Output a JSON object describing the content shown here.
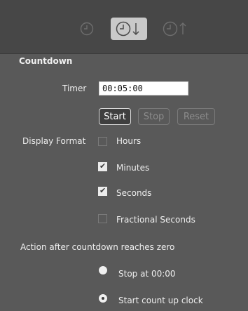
{
  "toolbar": {
    "modes": [
      {
        "name": "clock",
        "icon": "clock-icon",
        "active": false
      },
      {
        "name": "countdown",
        "icon": "clock-down-arrow-icon",
        "active": true
      },
      {
        "name": "countup",
        "icon": "clock-up-arrow-icon",
        "active": false
      }
    ]
  },
  "section": {
    "title": "Countdown"
  },
  "timer": {
    "label": "Timer",
    "value": "00:05:00"
  },
  "buttons": {
    "start": "Start",
    "stop": "Stop",
    "reset": "Reset"
  },
  "display_format": {
    "label": "Display Format",
    "options": [
      {
        "label": "Hours",
        "checked": false
      },
      {
        "label": "Minutes",
        "checked": true
      },
      {
        "label": "Seconds",
        "checked": true
      },
      {
        "label": "Fractional Seconds",
        "checked": false
      }
    ]
  },
  "action": {
    "label": "Action after countdown reaches zero",
    "options": [
      {
        "label": "Stop at 00:00",
        "selected": false
      },
      {
        "label": "Start count up clock",
        "selected": true
      }
    ]
  },
  "colors": {
    "background": "#474747",
    "panel": "#595959",
    "active_mode": "#c9c9c9"
  }
}
